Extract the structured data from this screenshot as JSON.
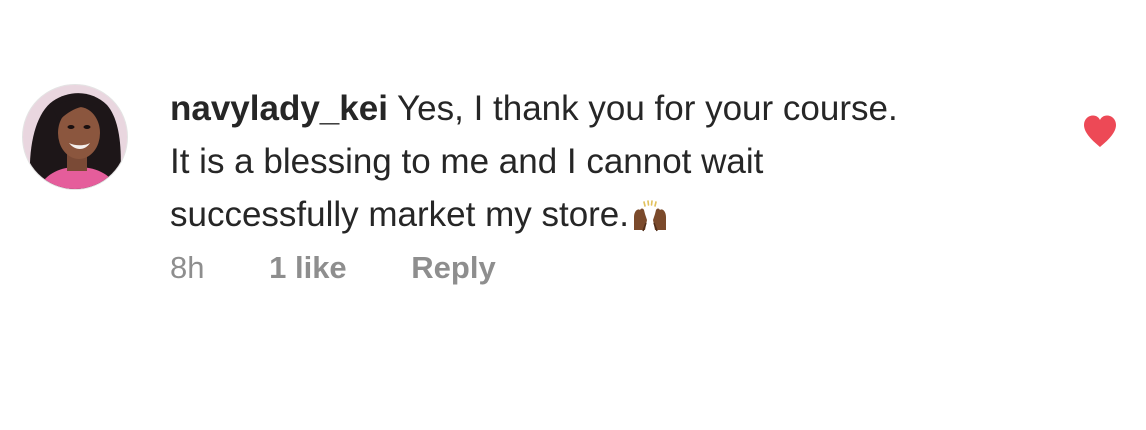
{
  "comment": {
    "username": "navylady_kei",
    "text_line_1": "Yes, I thank you for your course.",
    "text_line_2": "It is a blessing to me and I cannot wait",
    "text_line_3": "successfully market my store.",
    "emoji": "raising-hands-emoji",
    "timestamp": "8h",
    "likes": "1 like",
    "reply_label": "Reply",
    "liked": true,
    "heart_color": "#ed4956"
  },
  "colors": {
    "text": "#262626",
    "secondary_text": "#8e8e8e",
    "background": "#ffffff"
  },
  "icons": {
    "like": "heart-icon",
    "avatar": "user-avatar"
  }
}
